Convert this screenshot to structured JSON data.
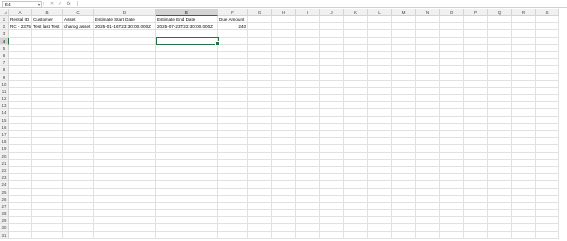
{
  "formula_bar": {
    "name_box": "E4",
    "name_box_arrow_icon": "chevron-down-icon",
    "separator": "⁝",
    "cancel_icon": "close-icon",
    "enter_icon": "checkmark-icon",
    "fx_label": "fx",
    "formula": ""
  },
  "sheet": {
    "active_cell": "E4",
    "active_column": "E",
    "active_row": "4",
    "columns": [
      {
        "letter": "A"
      },
      {
        "letter": "B"
      },
      {
        "letter": "C"
      },
      {
        "letter": "D"
      },
      {
        "letter": "E"
      },
      {
        "letter": "F"
      },
      {
        "letter": "G"
      },
      {
        "letter": "H"
      },
      {
        "letter": "I"
      },
      {
        "letter": "J"
      },
      {
        "letter": "K"
      },
      {
        "letter": "L"
      },
      {
        "letter": "M"
      },
      {
        "letter": "N"
      },
      {
        "letter": "O"
      },
      {
        "letter": "P"
      },
      {
        "letter": "Q"
      },
      {
        "letter": "R"
      },
      {
        "letter": "S"
      }
    ],
    "row_numbers": [
      "1",
      "2",
      "3",
      "4",
      "5",
      "6",
      "7",
      "8",
      "9",
      "10",
      "11",
      "12",
      "13",
      "14",
      "15",
      "16",
      "17",
      "18",
      "19",
      "20",
      "21",
      "22",
      "23",
      "24",
      "25",
      "26",
      "27",
      "28",
      "29",
      "30",
      "31"
    ],
    "rows": [
      [
        "Rental ID",
        "Customer",
        "Asset",
        "Estimate Start Date",
        "Estimate End Date",
        "Due Amount"
      ],
      [
        "RC - 2375",
        "Test last Test",
        "charog asset",
        "2025-01-16T23:30:00.000Z",
        "2025-07-23T22:30:00.000Z",
        "240"
      ]
    ]
  }
}
